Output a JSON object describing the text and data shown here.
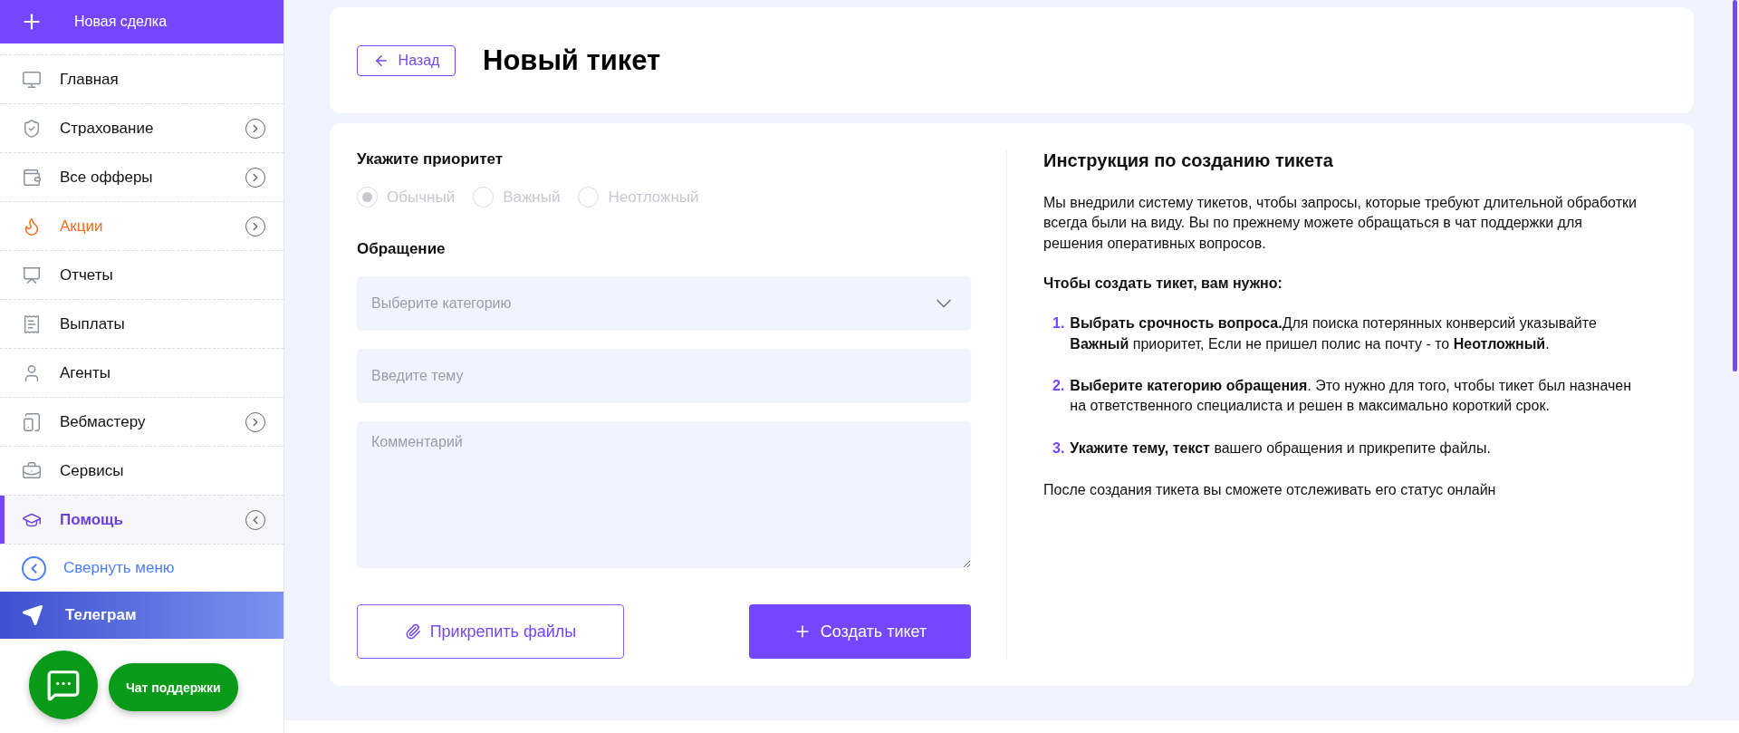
{
  "sidebar": {
    "new_deal": "Новая сделка",
    "items": [
      {
        "label": "Главная",
        "kind": "normal",
        "selected": false
      },
      {
        "label": "Страхование",
        "kind": "normal",
        "selected": false,
        "expanded": false
      },
      {
        "label": "Все офферы",
        "kind": "normal",
        "selected": false,
        "expanded": false
      },
      {
        "label": "Акции",
        "kind": "promo",
        "selected": false,
        "expanded": false
      },
      {
        "label": "Отчеты",
        "kind": "normal",
        "selected": false
      },
      {
        "label": "Выплаты",
        "kind": "normal",
        "selected": false
      },
      {
        "label": "Агенты",
        "kind": "normal",
        "selected": false
      },
      {
        "label": "Вебмастеру",
        "kind": "normal",
        "selected": false,
        "expanded": false
      },
      {
        "label": "Сервисы",
        "kind": "normal",
        "selected": false
      },
      {
        "label": "Помощь",
        "kind": "normal",
        "selected": true,
        "expanded": true
      }
    ],
    "collapse": "Свернуть меню",
    "telegram": "Телеграм",
    "support_chat": "Чат поддержки"
  },
  "header": {
    "back": "Назад",
    "title": "Новый тикет"
  },
  "form": {
    "priority_label": "Укажите приоритет",
    "priorities": [
      {
        "label": "Обычный",
        "selected": true
      },
      {
        "label": "Важный",
        "selected": false
      },
      {
        "label": "Неотложный",
        "selected": false
      }
    ],
    "priority_disabled": true,
    "request_label": "Обращение",
    "category": {
      "placeholder": "Выберите категорию"
    },
    "subject": {
      "placeholder": "Введите тему"
    },
    "comment": {
      "placeholder": "Комментарий"
    },
    "attach": "Прикрепить файлы",
    "create": "Создать тикет"
  },
  "instructions": {
    "title": "Инструкция по созданию тикета",
    "intro": "Мы внедрили систему тикетов, чтобы запросы, которые требуют длительной обработки всегда были на виду. Вы по прежнему можете обращаться в чат поддержки для решения оперативных вопросов.",
    "steps_title": "Чтобы создать тикет, вам нужно:",
    "steps": [
      {
        "number": "1.",
        "text": "**Выбрать срочность вопроса.**Для поиска потерянных конверсий указывайте **Важный** приоритет, Если не пришел полис на почту - то **Неотложный**."
      },
      {
        "number": "2.",
        "text": "**Выберите категорию обращения**. Это нужно для того, чтобы тикет был назначен на ответственного специалиста и решен в максимально короткий срок."
      },
      {
        "number": "3.",
        "text": "**Укажите тему, текст** вашего обращения и прикрепите файлы."
      }
    ],
    "outro": "После создания тикета вы сможете отслеживать его статус онлайн"
  }
}
